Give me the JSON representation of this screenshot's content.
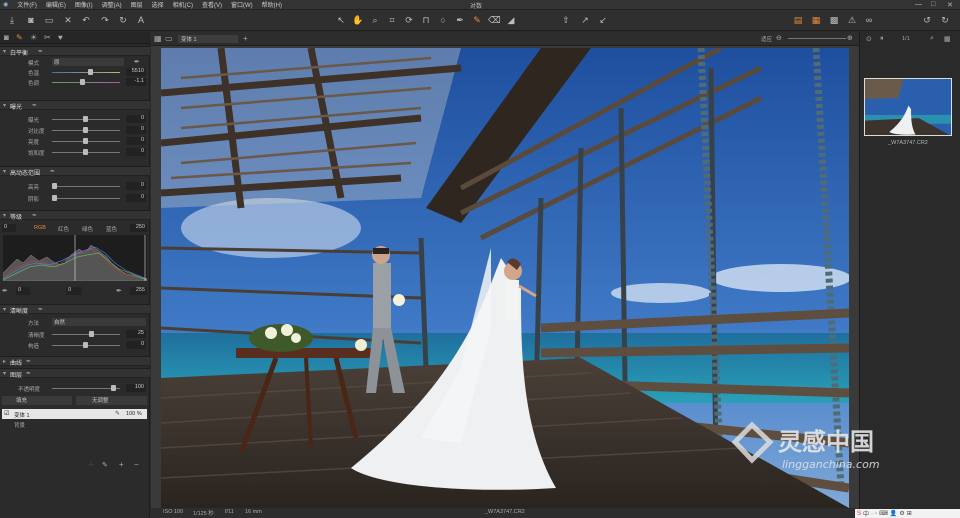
{
  "app_title": "对数",
  "menu": [
    "文件(F)",
    "编辑(E)",
    "图像(I)",
    "调整(A)",
    "图层",
    "选择",
    "相机(C)",
    "查看(V)",
    "窗口(W)",
    "帮助(H)"
  ],
  "window_controls": [
    "—",
    "□",
    "✕"
  ],
  "viewer": {
    "tab": "变体 1",
    "zoom_label": "适应",
    "page": "1/1"
  },
  "panels": {
    "white_balance": {
      "title": "白平衡",
      "rows": [
        {
          "label": "模式",
          "value": "原"
        },
        {
          "label": "色温",
          "value": "5510"
        },
        {
          "label": "色调",
          "value": "-1.1"
        }
      ]
    },
    "exposure": {
      "title": "曝光",
      "rows": [
        {
          "label": "曝光",
          "value": "0"
        },
        {
          "label": "对比度",
          "value": "0"
        },
        {
          "label": "亮度",
          "value": "0"
        },
        {
          "label": "饱和度",
          "value": "0"
        }
      ]
    },
    "hdr": {
      "title": "高动态范围",
      "rows": [
        {
          "label": "高亮",
          "value": "0"
        },
        {
          "label": "阴影",
          "value": "0"
        }
      ]
    },
    "levels": {
      "title": "等级",
      "in_low": "0",
      "in_high": "250",
      "tabs": [
        "RGB",
        "红色",
        "绿色",
        "蓝色"
      ],
      "out_low": "0",
      "out_mid": "0",
      "out_high": "255"
    },
    "clarity": {
      "title": "清晰度",
      "rows": [
        {
          "label": "方法",
          "value": "自然"
        },
        {
          "label": "清晰度",
          "value": "25"
        },
        {
          "label": "构造",
          "value": "0"
        }
      ]
    },
    "curve": {
      "title": "曲线"
    },
    "layers": {
      "title": "图层",
      "opacity_label": "不透明度",
      "opacity_value": "100",
      "dropdown": "填充",
      "add_label": "无调整",
      "layer_name": "变体 1",
      "layer_opacity": "100 %",
      "bg_label": "背景"
    }
  },
  "statusbar": {
    "iso": "ISO 100",
    "shutter": "1/125 秒",
    "aperture": "f/11",
    "focal": "16 mm",
    "filename": "_W7A3747.CR2"
  },
  "browser": {
    "caption": "_W7A3747.CR2"
  },
  "watermark": {
    "cn": "灵感中国",
    "url": "lingganchina.com"
  },
  "ime": [
    "S",
    "中",
    "·",
    "◦",
    "⌨",
    "👤",
    "⚙",
    "⊞"
  ]
}
